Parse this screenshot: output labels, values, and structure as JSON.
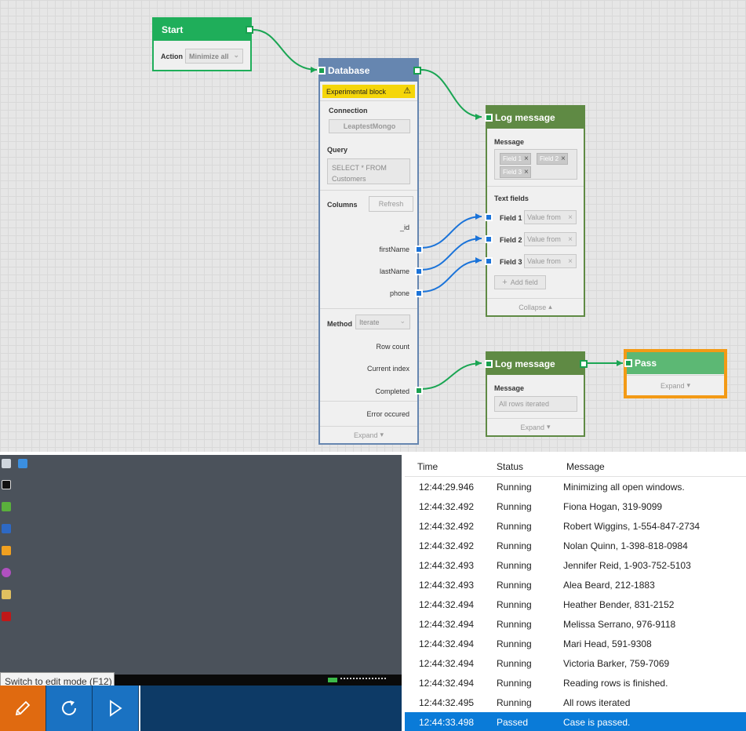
{
  "start": {
    "title": "Start",
    "action_label": "Action",
    "action_value": "Minimize all"
  },
  "database": {
    "title": "Database",
    "experimental": "Experimental block",
    "connection_label": "Connection",
    "connection_value": "LeaptestMongo",
    "query_label": "Query",
    "query_value": "SELECT * FROM Customers",
    "columns_label": "Columns",
    "refresh": "Refresh",
    "columns": [
      "_id",
      "firstName",
      "lastName",
      "phone"
    ],
    "method_label": "Method",
    "method_value": "Iterate",
    "outputs": [
      "Row count",
      "Current index",
      "Completed",
      "Error occured"
    ],
    "expand": "Expand"
  },
  "log1": {
    "title": "Log message",
    "message_label": "Message",
    "chips": [
      "Field 1",
      "Field 2",
      "Field 3"
    ],
    "text_fields_label": "Text fields",
    "fields": [
      {
        "label": "Field 1",
        "value": "Value from"
      },
      {
        "label": "Field 2",
        "value": "Value from"
      },
      {
        "label": "Field 3",
        "value": "Value from"
      }
    ],
    "add_field": "Add field",
    "collapse": "Collapse"
  },
  "log2": {
    "title": "Log message",
    "message_label": "Message",
    "message_value": "All rows iterated",
    "expand": "Expand"
  },
  "pass": {
    "title": "Pass",
    "expand": "Expand"
  },
  "tooltip": "Switch to edit mode (F12)",
  "log_table": {
    "headers": {
      "time": "Time",
      "status": "Status",
      "message": "Message"
    },
    "rows": [
      {
        "time": "12:44:29.946",
        "status": "Running",
        "message": "Minimizing all open windows."
      },
      {
        "time": "12:44:32.492",
        "status": "Running",
        "message": "Fiona Hogan, 319-9099"
      },
      {
        "time": "12:44:32.492",
        "status": "Running",
        "message": "Robert Wiggins, 1-554-847-2734"
      },
      {
        "time": "12:44:32.492",
        "status": "Running",
        "message": "Nolan Quinn, 1-398-818-0984"
      },
      {
        "time": "12:44:32.493",
        "status": "Running",
        "message": "Jennifer Reid, 1-903-752-5103"
      },
      {
        "time": "12:44:32.493",
        "status": "Running",
        "message": "Alea Beard, 212-1883"
      },
      {
        "time": "12:44:32.494",
        "status": "Running",
        "message": "Heather Bender, 831-2152"
      },
      {
        "time": "12:44:32.494",
        "status": "Running",
        "message": "Melissa Serrano, 976-9118"
      },
      {
        "time": "12:44:32.494",
        "status": "Running",
        "message": "Mari Head, 591-9308"
      },
      {
        "time": "12:44:32.494",
        "status": "Running",
        "message": "Victoria Barker, 759-7069"
      },
      {
        "time": "12:44:32.494",
        "status": "Running",
        "message": "Reading rows is finished."
      },
      {
        "time": "12:44:32.495",
        "status": "Running",
        "message": "All rows iterated"
      },
      {
        "time": "12:44:33.498",
        "status": "Passed",
        "message": "Case is passed."
      }
    ]
  },
  "colors": {
    "start": "#1fae5a",
    "database": "#6686b0",
    "log": "#5f8a44",
    "pass": "#5cb874",
    "highlight": "#f39a16",
    "wire_green": "#1aa553",
    "wire_blue": "#1a73d9",
    "selected_row": "#0a7bd8",
    "control_bar": "#0d3a66",
    "edit_button": "#e06a10"
  },
  "icons": [
    "warning-icon",
    "close-icon",
    "plus-icon",
    "chevron-down-icon",
    "chevron-up-icon",
    "pencil-icon",
    "refresh-icon",
    "play-icon"
  ]
}
